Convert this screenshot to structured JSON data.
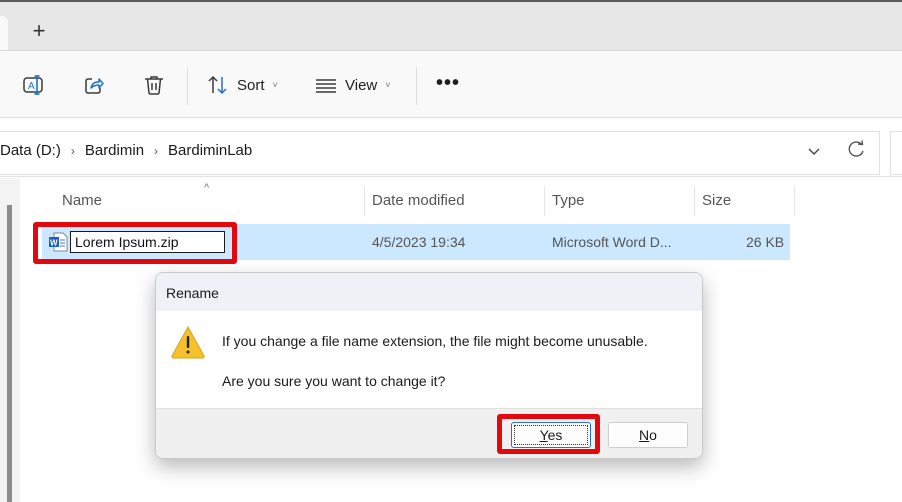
{
  "tabstrip": {
    "new_tab_label": "+"
  },
  "toolbar": {
    "rename_icon": "rename-icon",
    "share_icon": "share-icon",
    "delete_icon": "trash-icon",
    "sort_label": "Sort",
    "view_label": "View",
    "more_label": "•••",
    "caret": "˅"
  },
  "address": {
    "crumbs": [
      "Data (D:)",
      "Bardimin",
      "BardiminLab"
    ],
    "separator": "›"
  },
  "list": {
    "columns": [
      "Name",
      "Date modified",
      "Type",
      "Size"
    ],
    "sort_indicator": "^",
    "rows": [
      {
        "name": "Lorem Ipsum.zip",
        "date_modified": "4/5/2023 19:34",
        "type": "Microsoft Word D...",
        "size": "26 KB",
        "icon": "word-document-icon"
      }
    ]
  },
  "dialog": {
    "title": "Rename",
    "message_line1": "If you change a file name extension, the file might become unusable.",
    "message_line2": "Are you sure you want to change it?",
    "yes_mnemonic": "Y",
    "yes_rest": "es",
    "no_mnemonic": "N",
    "no_rest": "o"
  },
  "colors": {
    "highlight_red": "#e1090e",
    "selection_blue": "#cce8ff",
    "accent_blue": "#2a6fcf"
  }
}
